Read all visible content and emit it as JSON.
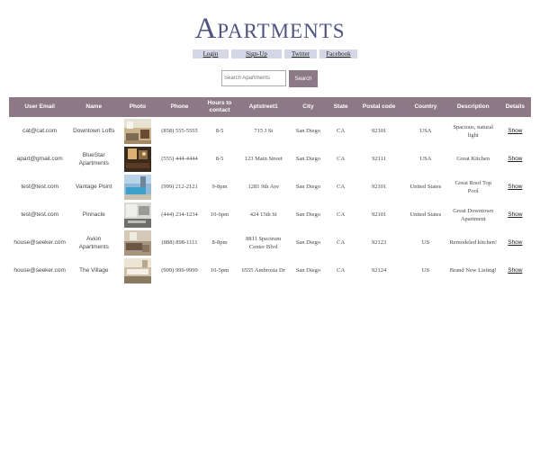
{
  "page": {
    "title": "Apartments"
  },
  "nav": [
    "Login",
    "Sign-Up",
    "Twitter",
    "Facebook"
  ],
  "search": {
    "placeholder": "Search Apartments",
    "button_label": "Search"
  },
  "table": {
    "headers": [
      "User Email",
      "Name",
      "Photo",
      "Phone",
      "Hours to contact",
      "Aptstreet1",
      "City",
      "State",
      "Postal code",
      "Country",
      "Description",
      "Details"
    ],
    "rows": [
      {
        "email": "cat@cat.com",
        "name": "Downtown Lofts",
        "photo": "apartment-interior-photo",
        "phone": "(858) 555-5555",
        "hours": "8-5",
        "street": "715 J St",
        "city": "San Diego",
        "state": "CA",
        "postal": "92101",
        "country": "USA",
        "description": "Spacious, natural light",
        "details": "Show"
      },
      {
        "email": "apart@gmail.com",
        "name": "BlueStar Apartments",
        "photo": "apartment-interior-photo",
        "phone": "(555) 444-4444",
        "hours": "8-5",
        "street": "123 Main Street",
        "city": "San Diego",
        "state": "CA",
        "postal": "92111",
        "country": "USA",
        "description": "Great Kitchen",
        "details": "Show"
      },
      {
        "email": "test@test.com",
        "name": "Vantage Point",
        "photo": "rooftop-pool-photo",
        "phone": "(999) 212-2121",
        "hours": "9-8pm",
        "street": "1281 9th Ave",
        "city": "San Diego",
        "state": "CA",
        "postal": "92101",
        "country": "United States",
        "description": "Great Roof Top Pool",
        "details": "Show"
      },
      {
        "email": "test@test.com",
        "name": "Pinnacle",
        "photo": "kitchen-photo",
        "phone": "(444) 234-1234",
        "hours": "10-6pm",
        "street": "424 15th St",
        "city": "San Diego",
        "state": "CA",
        "postal": "92101",
        "country": "United States",
        "description": "Great Downtown Apartment",
        "details": "Show"
      },
      {
        "email": "house@seeker.com",
        "name": "Avion Apartments",
        "photo": "living-room-photo",
        "phone": "(888) 898-1111",
        "hours": "8-8pm",
        "street": "8811 Spectrum Center Blvd",
        "city": "San Diego",
        "state": "CA",
        "postal": "92123",
        "country": "US",
        "description": "Remodeled kitchen!",
        "details": "Show"
      },
      {
        "email": "house@seeker.com",
        "name": "The Village",
        "photo": "kitchen-photo",
        "phone": "(999) 999-9999",
        "hours": "10-5pm",
        "street": "6555 Ambrosia Dr",
        "city": "San Diego",
        "state": "CA",
        "postal": "92124",
        "country": "US",
        "description": "Brand New Listing!",
        "details": "Show"
      }
    ]
  }
}
